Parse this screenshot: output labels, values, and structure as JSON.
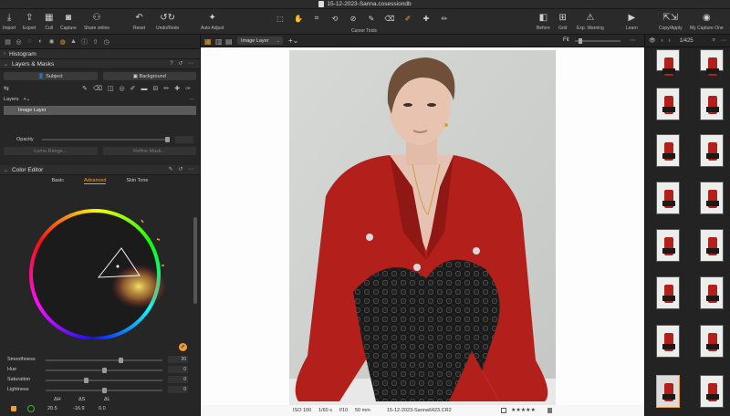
{
  "window": {
    "title": "15-12-2023-Sanna.cosessiondb"
  },
  "toolbar": {
    "import": "Import",
    "export": "Export",
    "cull": "Cull",
    "capture": "Capture",
    "share": "Share online",
    "reset": "Reset",
    "undo": "Undo/Redo",
    "auto": "Auto Adjust",
    "cursor_tools": "Cursor Tools",
    "before": "Before",
    "grid": "Grid",
    "exp_warning": "Exp. Warning",
    "learn": "Learn",
    "copyapply": "Copy/Apply",
    "mycapture": "My Capture One"
  },
  "left": {
    "histogram": "Histogram",
    "layers_masks": "Layers & Masks",
    "subject": "Subject",
    "background": "Background",
    "layers_label": "Layers",
    "image_layer": "Image Layer",
    "opacity": "Opacity",
    "luma": "Luma Range...",
    "refine": "Refine Mask...",
    "color_editor": "Color Editor",
    "tabs": {
      "basic": "Basic",
      "advanced": "Advanced",
      "skin": "Skin Tone"
    },
    "adjust": [
      {
        "name": "Smoothness",
        "value": "20",
        "pos": 0.65
      },
      {
        "name": "Hue",
        "value": "0",
        "pos": 0.5
      },
      {
        "name": "Saturation",
        "value": "0",
        "pos": 0.34
      },
      {
        "name": "Lightness",
        "value": "0",
        "pos": 0.5
      }
    ],
    "delta_labels": {
      "h": "ΔH",
      "s": "ΔS",
      "l": "ΔL"
    },
    "delta_values": {
      "h": "20.5",
      "s": "-16.9",
      "l": "0.0"
    }
  },
  "viewer": {
    "layer_select": "Image Layer",
    "zoom": "Fit",
    "info": {
      "iso": "ISO 100",
      "shutter": "1/60 s",
      "aperture": "f/10",
      "focal": "50 mm",
      "file": "15-12-2023-Sanna6423.CR2",
      "stars": "★★★★★"
    }
  },
  "browser": {
    "count": "1/425"
  },
  "colors": {
    "accent": "#f0a030",
    "jacket": "#b3201c",
    "panel": "#262626"
  }
}
